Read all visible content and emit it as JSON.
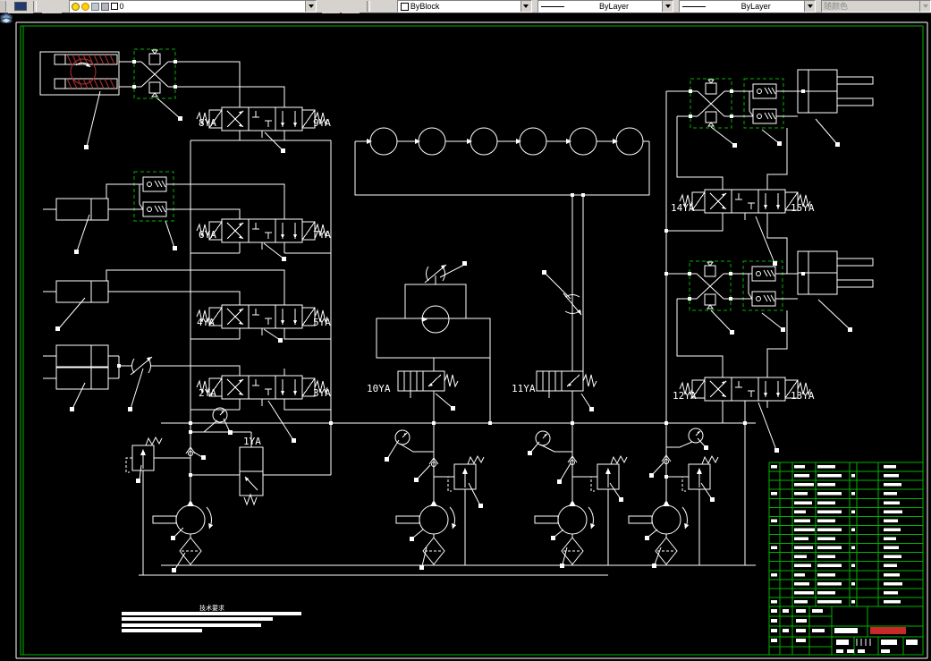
{
  "toolbar": {
    "layer_combo": {
      "value": "0"
    },
    "color_combo": {
      "value": "ByBlock"
    },
    "linetype_combo": {
      "value": "ByLayer"
    },
    "lineweight_combo": {
      "value": "ByLayer"
    },
    "plotstyle_combo": {
      "value": "随颜色"
    }
  },
  "schematic": {
    "labels": {
      "ya1": "1YA",
      "ya2": "2YA",
      "ya3": "3YA",
      "ya4": "4YA",
      "ya5": "5YA",
      "ya6": "6YA",
      "ya7": "7YA",
      "ya8": "8YA",
      "ya9": "9YA",
      "ya10": "10YA",
      "ya11": "11YA",
      "ya12": "12YA",
      "ya13": "13YA",
      "ya14": "14YA",
      "ya15": "15YA"
    },
    "tech_requirements_title": "技术要求"
  },
  "colors": {
    "background": "#000000",
    "line_white": "#ffffff",
    "frame_green": "#00b400",
    "highlight_red": "#b43232",
    "title_red_text": "#c82828",
    "toolbar_bg": "#d6d3ce"
  }
}
